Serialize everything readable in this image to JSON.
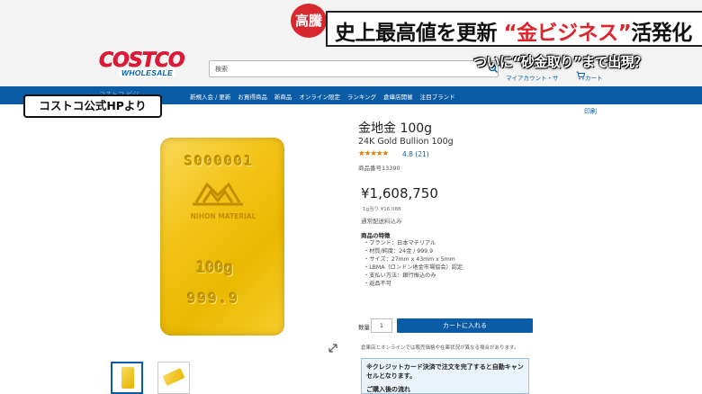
{
  "news": {
    "badge": "高騰",
    "headline_main": "史上最高値を更新",
    "headline_quoted": "“金ビジネス”",
    "headline_end": "活発化",
    "sub_headline": "ついに“砂金取り”まで出現？",
    "source": "コストコ公式HPより"
  },
  "site": {
    "logo_main": "COSTCO",
    "logo_sub": "WHOLESALE",
    "search_placeholder": "検索",
    "account": "マイアカウント・サ",
    "cart": "カート",
    "nav_faded": "コストコ ビジ",
    "nav": [
      "新規入会 / 更新",
      "お買得商品",
      "新商品",
      "オンライン限定",
      "ランキング",
      "倉庫店開催",
      "注目ブランド"
    ]
  },
  "product": {
    "print": "印刷",
    "title": "金地金 100g",
    "subtitle": "24K Gold Bullion 100g",
    "stars": "★★★★★",
    "rating": "4.8 (21)",
    "item_number": "商品番号13390",
    "price": "¥1,608,750",
    "unit_price": "1g当り ¥16,088",
    "shipping": "通常配送料込み",
    "features_title": "商品の特徴",
    "features": [
      "ブランド：日本マテリアル",
      "材質/純度：24金 / 999.9",
      "サイズ：27mm x 43mm x 5mm",
      "LBMA（ロンドン地金市場協会）認定",
      "支払い方法：銀行振込のみ",
      "返品不可"
    ],
    "qty_label": "数量",
    "qty_value": "1",
    "add_to_cart": "カートに入れる",
    "store_note": "倉庫店とオンラインでは販売価格や在庫状況が異なる場合があります。",
    "notice": "※クレジットカード決済で注文を完了すると自動キャンセルとなります。",
    "notice_more": "ご購入後の流れ"
  },
  "gold_bar": {
    "serial": "S000001",
    "brand": "NIHON MATERIAL",
    "weight": "100g",
    "purity": "999.9"
  },
  "colors": {
    "costco_red": "#e31837",
    "costco_blue": "#0b5ca7",
    "news_red": "#d8282e",
    "gold": "#f3c51a"
  }
}
